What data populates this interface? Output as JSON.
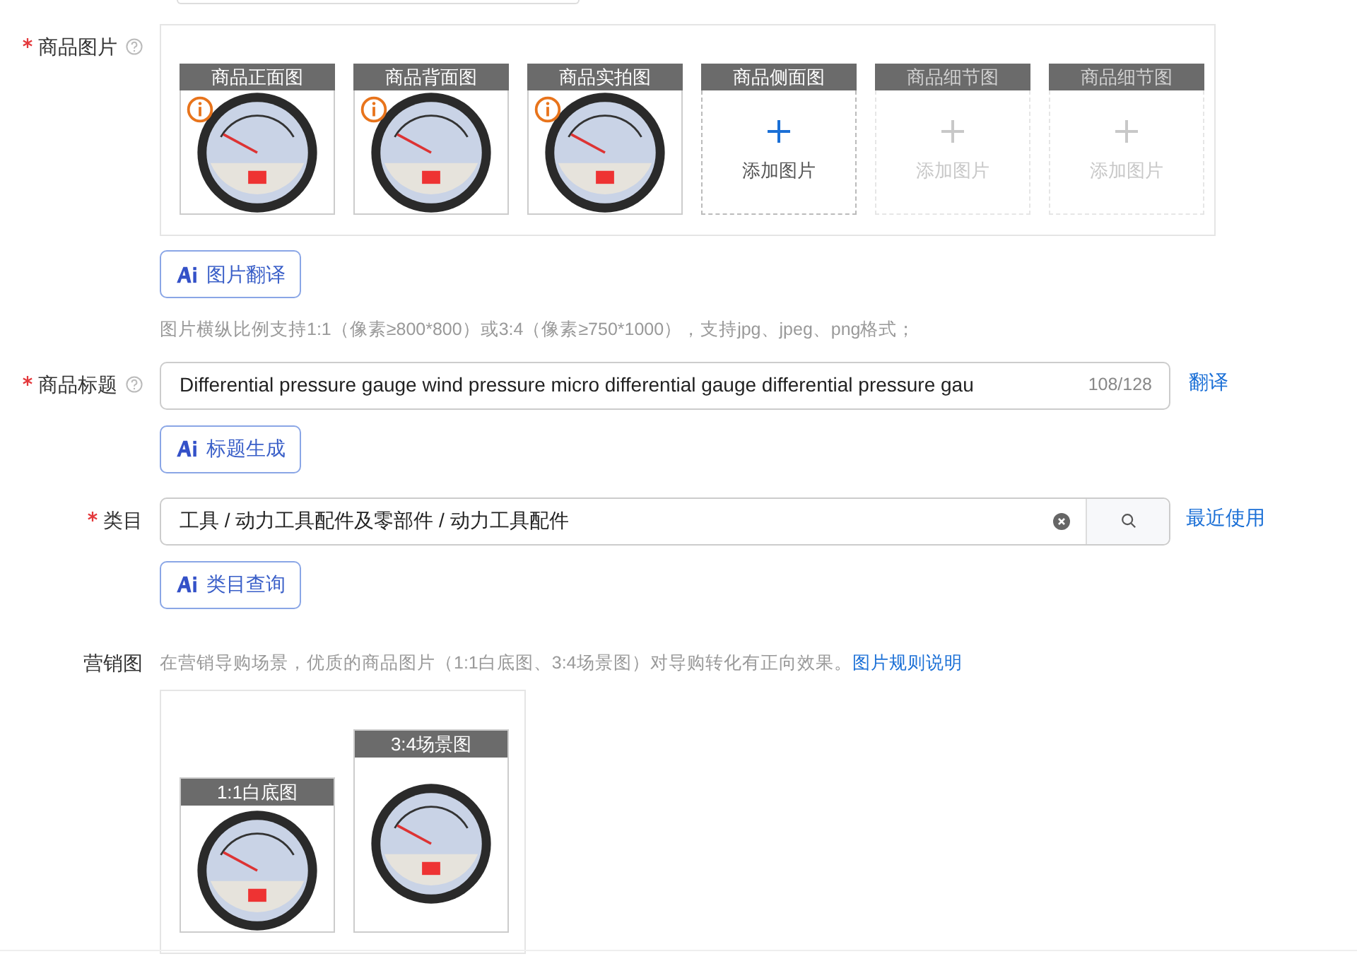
{
  "product_images": {
    "label": "商品图片",
    "required": true,
    "slots": [
      {
        "kind": "photo",
        "caption": "商品正面图",
        "warning": true
      },
      {
        "kind": "photo",
        "caption": "商品背面图",
        "warning": true
      },
      {
        "kind": "photo",
        "caption": "商品实拍图",
        "warning": true
      },
      {
        "kind": "empty",
        "caption": "商品侧面图",
        "add_label": "添加图片",
        "disabled": false
      },
      {
        "kind": "empty",
        "caption": "商品细节图",
        "add_label": "添加图片",
        "disabled": true
      },
      {
        "kind": "empty",
        "caption": "商品细节图",
        "add_label": "添加图片",
        "disabled": true
      }
    ],
    "ai_button": "图片翻译",
    "hint": "图片横纵比例支持1:1（像素≥800*800）或3:4（像素≥750*1000），支持jpg、jpeg、png格式；"
  },
  "product_title": {
    "label": "商品标题",
    "required": true,
    "value": "Differential pressure gauge wind pressure micro differential gauge differential pressure gau",
    "counter": "108/128",
    "link": "翻译",
    "ai_button": "标题生成"
  },
  "category": {
    "label": "类目",
    "required": true,
    "value": "工具 / 动力工具配件及零部件 / 动力工具配件",
    "link": "最近使用",
    "ai_button": "类目查询"
  },
  "marketing": {
    "label": "营销图",
    "hint": "在营销导购场景，优质的商品图片（1:1白底图、3:4场景图）对导购转化有正向效果。",
    "link": "图片规则说明",
    "images": [
      {
        "kind": "square",
        "caption": "1:1白底图"
      },
      {
        "kind": "portrait",
        "caption": "3:4场景图"
      }
    ]
  }
}
